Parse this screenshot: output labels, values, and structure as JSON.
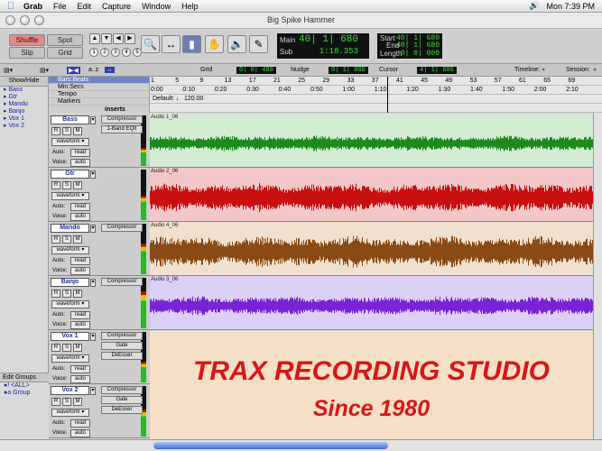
{
  "menubar": {
    "app_name": "Grab",
    "items": [
      "File",
      "Edit",
      "Capture",
      "Window",
      "Help"
    ],
    "clock": "Mon 7:39 PM"
  },
  "window": {
    "title": "Big Spike Hammer"
  },
  "toolbar": {
    "modes": [
      "Shuffle",
      "Spot",
      "Slip",
      "Grid"
    ],
    "nav_numbers": [
      "1",
      "2",
      "3",
      "4",
      "5"
    ],
    "main_label": "Main",
    "main_value": "40| 1| 680",
    "sub_label": "Sub",
    "sub_value": "1:18.353",
    "start_label": "Start",
    "start_value": "40| 1| 680",
    "end_label": "End",
    "end_value": "40| 1| 680",
    "length_label": "Length",
    "length_value": "0| 0| 000"
  },
  "rulerbar": {
    "grid_label": "Grid",
    "grid_value": "0| 0| 480",
    "nudge_label": "Nudge",
    "nudge_value": "0| 1| 000",
    "cursor_label": "Cursor",
    "cursor_value": "4| 1| 606",
    "timeline_label": "Timeline:",
    "session_label": "Session:"
  },
  "leftpanel": {
    "header": "Show/Hide",
    "tracks": [
      "Bass",
      "Gtr",
      "Mando",
      "Banjo",
      "Vox 1",
      "Vox 2"
    ],
    "edit_groups_header": "Edit Groups",
    "groups": [
      "<ALL>",
      "Group"
    ]
  },
  "rulers": {
    "labels": [
      "Bars:Beats",
      "Min:Secs",
      "Tempo",
      "Markers"
    ],
    "bars": [
      "1",
      "5",
      "9",
      "13",
      "17",
      "21",
      "25",
      "29",
      "33",
      "37",
      "41",
      "45",
      "49",
      "53",
      "57",
      "61",
      "65",
      "69"
    ],
    "mins": [
      "0:00",
      "0:10",
      "0:20",
      "0:30",
      "0:40",
      "0:50",
      "1:00",
      "1:10",
      "1:20",
      "1:30",
      "1:40",
      "1:50",
      "2:00",
      "2:10"
    ],
    "tempo": "Default: ♩ 120.00",
    "inserts_header": "inserts"
  },
  "tracks": [
    {
      "name": "Bass",
      "clip": "Audio 1_06",
      "color": "#d3ebd3",
      "wave": "#1e8a1e",
      "inserts": [
        "Compressor",
        "1-Band EQII"
      ],
      "voice": "auto",
      "auto": "read",
      "mode": "waveform"
    },
    {
      "name": "Gtr",
      "clip": "Audio 2_06",
      "color": "#f3c7c7",
      "wave": "#c81010",
      "inserts": [],
      "voice": "auto",
      "auto": "read",
      "mode": "waveform"
    },
    {
      "name": "Mando",
      "clip": "Audio 4_06",
      "color": "#f0e0cf",
      "wave": "#8a4a16",
      "inserts": [
        "Compressor"
      ],
      "voice": "auto",
      "auto": "read",
      "mode": "waveform"
    },
    {
      "name": "Banjo",
      "clip": "Audio 3_06",
      "color": "#dccff6",
      "wave": "#7a22d6",
      "inserts": [
        "Compressor"
      ],
      "voice": "auto",
      "auto": "read",
      "mode": "waveform"
    },
    {
      "name": "Vox 1",
      "clip": "",
      "color": "#f5dfc6",
      "wave": "",
      "inserts": [
        "Compressor",
        "Gate",
        "DeEsser"
      ],
      "voice": "auto",
      "auto": "read",
      "mode": "waveform"
    },
    {
      "name": "Vox 2",
      "clip": "",
      "color": "#f5dfc6",
      "wave": "",
      "inserts": [
        "Compressor",
        "Gate",
        "DeEsser"
      ],
      "voice": "auto",
      "auto": "read",
      "mode": "waveform"
    }
  ],
  "logo": {
    "line1": "TRAX RECORDING STUDIO",
    "line2": "Since 1980"
  }
}
